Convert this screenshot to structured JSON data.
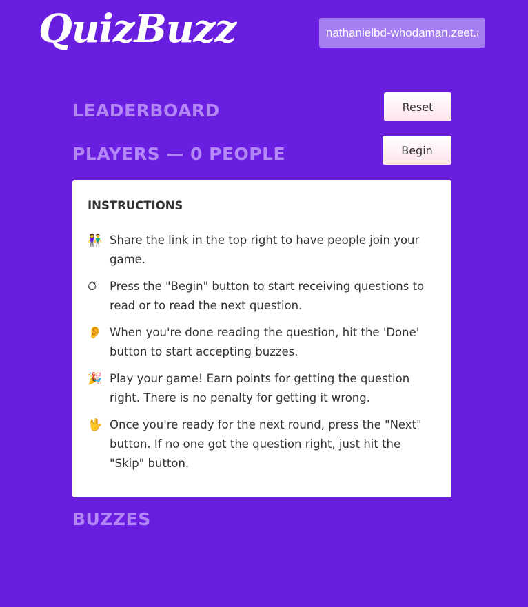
{
  "app": {
    "logo_text": "QuizBuzz"
  },
  "header": {
    "share_link_value": "nathanielbd-whodaman.zeet.app"
  },
  "colors": {
    "background": "#6a1fe0",
    "heading": "#b388f5",
    "share_link_bg": "#a57ff0",
    "card_bg": "#ffffff",
    "button_bg": "#fde4ea",
    "text": "#333333"
  },
  "leaderboard": {
    "heading": "LEADERBOARD",
    "reset_label": "Reset"
  },
  "players": {
    "heading": "PLAYERS — 0 PEOPLE",
    "begin_label": "Begin"
  },
  "instructions": {
    "title": "INSTRUCTIONS",
    "steps": [
      {
        "icon": "people-holding-hands-icon",
        "glyph": "👫",
        "text": "Share the link in the top right to have people join your game."
      },
      {
        "icon": "stopwatch-icon",
        "glyph": "⏱",
        "text": "Press the \"Begin\" button to start receiving questions to read or to read the next question."
      },
      {
        "icon": "ear-icon",
        "glyph": "👂",
        "text": "When you're done reading the question, hit the 'Done' button to start accepting buzzes."
      },
      {
        "icon": "party-popper-icon",
        "glyph": "🎉",
        "text": "Play your game! Earn points for getting the question right. There is no penalty for getting it wrong."
      },
      {
        "icon": "vulcan-salute-icon",
        "glyph": "🖖",
        "text": "Once you're ready for the next round, press the \"Next\" button. If no one got the question right, just hit the \"Skip\" button."
      }
    ]
  },
  "buzzes": {
    "heading": "BUZZES"
  }
}
